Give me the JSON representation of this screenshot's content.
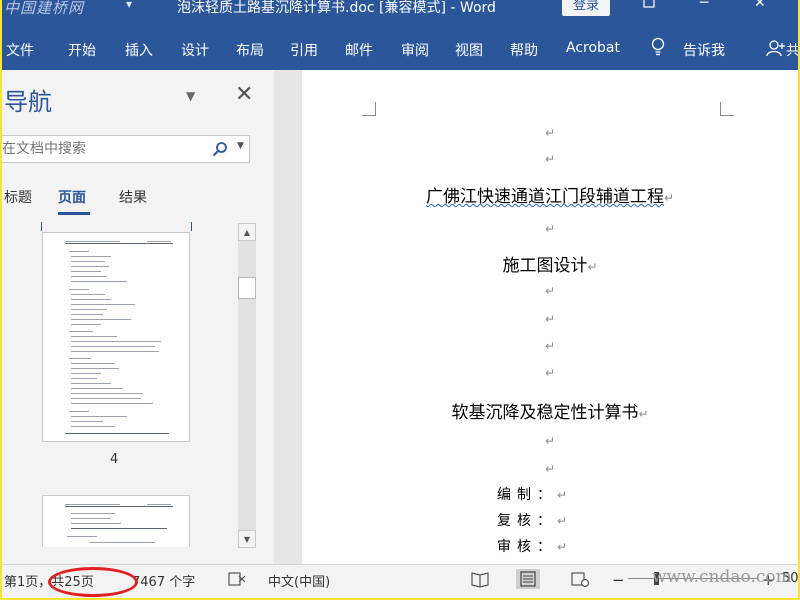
{
  "window": {
    "watermark": "中国建桥网",
    "document_title": "泡沫轻质土路基沉降计算书.doc [兼容模式] - Word",
    "login_label": "登录",
    "restore_icon": "restore-icon",
    "close_icon": "close-icon"
  },
  "ribbon": {
    "tabs": [
      "文件",
      "开始",
      "插入",
      "设计",
      "布局",
      "引用",
      "邮件",
      "审阅",
      "视图",
      "帮助",
      "Acrobat",
      "告诉我",
      "共"
    ]
  },
  "nav_pane": {
    "title": "导航",
    "search_placeholder": "在文档中搜索",
    "tabs": [
      "标题",
      "页面",
      "结果"
    ],
    "active_tab": "页面",
    "thumbnails": [
      {
        "page_number": "4"
      },
      {
        "page_number": ""
      }
    ]
  },
  "document": {
    "paragraphs": [
      {
        "text": "",
        "mark": "↵"
      },
      {
        "text": "",
        "mark": "↵"
      },
      {
        "text": "广佛江快速通道江门段辅道工程",
        "mark": "↵"
      },
      {
        "text": "",
        "mark": "↵"
      },
      {
        "text": "施工图设计",
        "mark": "↵"
      },
      {
        "text": "",
        "mark": "↵"
      },
      {
        "text": "",
        "mark": "↵"
      },
      {
        "text": "",
        "mark": "↵"
      },
      {
        "text": "",
        "mark": "↵"
      },
      {
        "text": "软基沉降及稳定性计算书",
        "mark": "↵"
      },
      {
        "text": "",
        "mark": "↵"
      },
      {
        "text": "",
        "mark": "↵"
      }
    ],
    "signatures": [
      {
        "label": "编制：",
        "mark": "↵"
      },
      {
        "label": "复核：",
        "mark": "↵"
      },
      {
        "label": "审核：",
        "mark": "↵"
      }
    ]
  },
  "status_bar": {
    "page_info": "第1页，共25页",
    "word_count": "7467 个字",
    "language": "中文(中国)",
    "zoom_minus": "−",
    "zoom_plus": "+",
    "zoom_level": "50"
  },
  "overlay": {
    "watermark_site": "www.cndao.com"
  },
  "colors": {
    "brand": "#2b579a",
    "annotation": "#e02020",
    "outer_border": "#f6e533"
  }
}
